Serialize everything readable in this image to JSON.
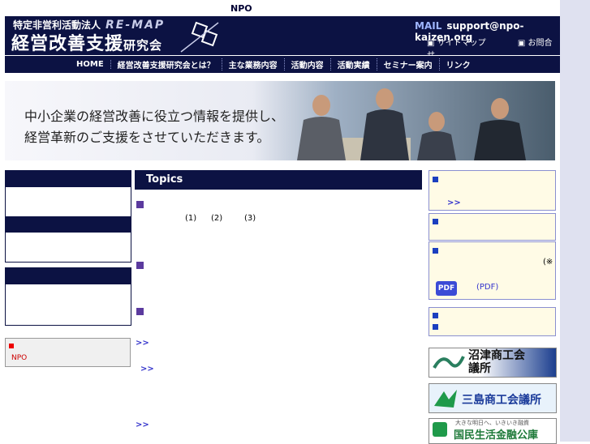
{
  "top_label": "NPO",
  "header": {
    "org_kind": "特定非営利活動法人",
    "org_name_main": "経営改善支援",
    "org_name_suffix": "研究会",
    "logo_text": "RE-MAP",
    "mail_label": "MAIL",
    "mail_address": "support@npo-kaizen.org",
    "sitemap_label": "サイトマップ",
    "contact_label": "お問合せ"
  },
  "nav": {
    "items": [
      "HOME",
      "経営改善支援研究会とは？",
      "主な業務内容",
      "活動内容",
      "活動実績",
      "セミナー案内",
      "リンク"
    ]
  },
  "hero": {
    "line1": "中小企業の経営改善に役立つ情報を提供し、",
    "line2": "経営革新のご支援をさせていただきます。"
  },
  "left": {
    "npo_label": "NPO"
  },
  "topics": {
    "title": "Topics",
    "nums": [
      "(1)",
      "(2)",
      "(3)"
    ],
    "more": [
      ">>",
      ">>",
      ">>"
    ]
  },
  "right": {
    "more": ">>",
    "asterisk": "(※",
    "pdf_badge": "PDF",
    "pdf_label": "(PDF)"
  },
  "banners": {
    "numazu": "沼津商工会議所",
    "mishima": "三島商工会議所",
    "kokumin": "国民生活金融公庫",
    "kokumin_sub": "大きな明日へ、いきいき融資"
  },
  "colors": {
    "navy": "#0c1243",
    "accent_purple": "#5b3a9e",
    "accent_blue": "#1b3fbf"
  }
}
